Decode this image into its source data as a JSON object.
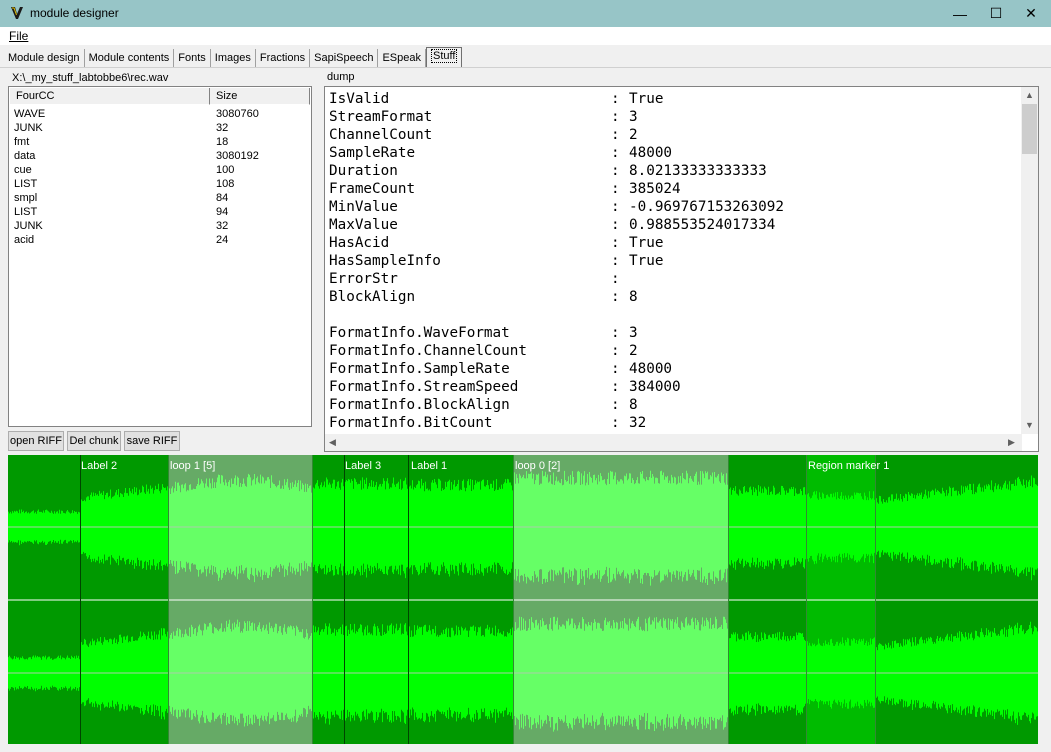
{
  "window": {
    "title": "module designer",
    "minimize": "—",
    "maximize": "☐",
    "close": "✕"
  },
  "menu": {
    "file": "File"
  },
  "tabs": [
    "Module design",
    "Module contents",
    "Fonts",
    "Images",
    "Fractions",
    "SapiSpeech",
    "ESpeak",
    "Stuff"
  ],
  "active_tab": "Stuff",
  "file_path": "X:\\_my_stuff_labtobbe6\\rec.wav",
  "dump_label": "dump",
  "chunk_list": {
    "headers": {
      "fourcc": "FourCC",
      "size": "Size"
    },
    "rows": [
      {
        "fourcc": "WAVE",
        "size": "3080760"
      },
      {
        "fourcc": "JUNK",
        "size": "32"
      },
      {
        "fourcc": "fmt ",
        "size": "18"
      },
      {
        "fourcc": "data",
        "size": "3080192"
      },
      {
        "fourcc": "cue ",
        "size": "100"
      },
      {
        "fourcc": "LIST",
        "size": "108"
      },
      {
        "fourcc": "smpl",
        "size": "84"
      },
      {
        "fourcc": "LIST",
        "size": "94"
      },
      {
        "fourcc": "JUNK",
        "size": "32"
      },
      {
        "fourcc": "acid",
        "size": "24"
      }
    ]
  },
  "buttons": {
    "open_riff": "open RIFF",
    "del_chunk": "Del chunk",
    "save_riff": "save RIFF"
  },
  "dump": {
    "separator": ":",
    "lines": [
      {
        "key": "IsValid",
        "value": "True"
      },
      {
        "key": "StreamFormat",
        "value": "3"
      },
      {
        "key": "ChannelCount",
        "value": "2"
      },
      {
        "key": "SampleRate",
        "value": "48000"
      },
      {
        "key": "Duration",
        "value": "8.02133333333333"
      },
      {
        "key": "FrameCount",
        "value": "385024"
      },
      {
        "key": "MinValue",
        "value": "-0.969767153263092"
      },
      {
        "key": "MaxValue",
        "value": "0.988553524017334"
      },
      {
        "key": "HasAcid",
        "value": "True"
      },
      {
        "key": "HasSampleInfo",
        "value": "True"
      },
      {
        "key": "ErrorStr",
        "value": ""
      },
      {
        "key": "BlockAlign",
        "value": "8"
      },
      {
        "key": "",
        "value": ""
      },
      {
        "key": "FormatInfo.WaveFormat",
        "value": "3"
      },
      {
        "key": "FormatInfo.ChannelCount",
        "value": "2"
      },
      {
        "key": "FormatInfo.SampleRate",
        "value": "48000"
      },
      {
        "key": "FormatInfo.StreamSpeed",
        "value": "384000"
      },
      {
        "key": "FormatInfo.BlockAlign",
        "value": "8"
      },
      {
        "key": "FormatInfo.BitCount",
        "value": "32"
      }
    ]
  },
  "waveform": {
    "markers": [
      "Label 2",
      "Label 3",
      "Label 1"
    ],
    "regions": [
      "loop 1 [5]",
      "loop 0 [2]",
      "Region marker 1"
    ],
    "colors": {
      "background": "#009900",
      "wave": "#00ff00",
      "loop_region": "#66aa66",
      "loop_wave": "#66ff66",
      "marker_region": "#00bb00",
      "marker_line": "#004400"
    }
  }
}
